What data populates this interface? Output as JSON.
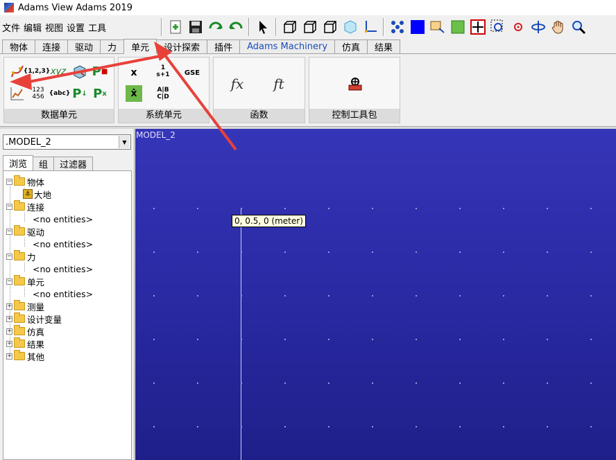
{
  "window": {
    "title": "Adams View Adams 2019"
  },
  "menu": [
    "文件",
    "编辑",
    "视图",
    "设置",
    "工具"
  ],
  "toolbar": {
    "icons": [
      "new-model-icon",
      "save-icon",
      "undo-icon",
      "redo-icon",
      "select-icon",
      "view-front-icon",
      "view-top-icon",
      "view-right-icon",
      "view-iso-icon",
      "triad-icon",
      "icons-toggle-icon",
      "render-icon",
      "zoom-box-icon",
      "fit-icon",
      "fit-all-icon",
      "zoom-region-icon",
      "center-icon",
      "rotate-icon",
      "pan-icon",
      "zoom-icon"
    ]
  },
  "tabs": [
    "物体",
    "连接",
    "驱动",
    "力",
    "单元",
    "设计探索",
    "插件",
    "Adams Machinery",
    "仿真",
    "结果"
  ],
  "active_tab": "单元",
  "ribbon": {
    "groups": [
      {
        "label": "数据单元"
      },
      {
        "label": "系统单元"
      },
      {
        "label": "函数"
      },
      {
        "label": "控制工具包"
      }
    ],
    "icon_text": {
      "array": "{1,2,3}",
      "xyz": "xyz",
      "matrix": "123\n456",
      "string": "{abc}",
      "state_x": "x",
      "state_xdot": "ẋ",
      "tf": "1\ns+1",
      "gse": "GSE",
      "lse": "A|B\nC|D",
      "fx": "fx",
      "ft": "ft"
    }
  },
  "browser": {
    "model": ".MODEL_2",
    "subtabs": [
      "浏览",
      "组",
      "过滤器"
    ],
    "tree": [
      {
        "label": "物体",
        "expanded": true,
        "children": [
          "大地"
        ]
      },
      {
        "label": "连接",
        "expanded": true,
        "children": [
          "<no entities>"
        ]
      },
      {
        "label": "驱动",
        "expanded": true,
        "children": [
          "<no entities>"
        ]
      },
      {
        "label": "力",
        "expanded": true,
        "children": [
          "<no entities>"
        ]
      },
      {
        "label": "单元",
        "expanded": true,
        "children": [
          "<no entities>"
        ]
      },
      {
        "label": "测量",
        "expanded": false
      },
      {
        "label": "设计变量",
        "expanded": false
      },
      {
        "label": "仿真",
        "expanded": false
      },
      {
        "label": "结果",
        "expanded": false
      },
      {
        "label": "其他",
        "expanded": false
      }
    ]
  },
  "viewport": {
    "model_name": "MODEL_2",
    "coord_readout": "0, 0.5, 0 (meter)"
  },
  "colors": {
    "viewport_top": "#3535b8",
    "viewport_bottom": "#1f1f8a",
    "annotation_arrow": "#e8413a",
    "tab_link": "#1a4bb8"
  }
}
